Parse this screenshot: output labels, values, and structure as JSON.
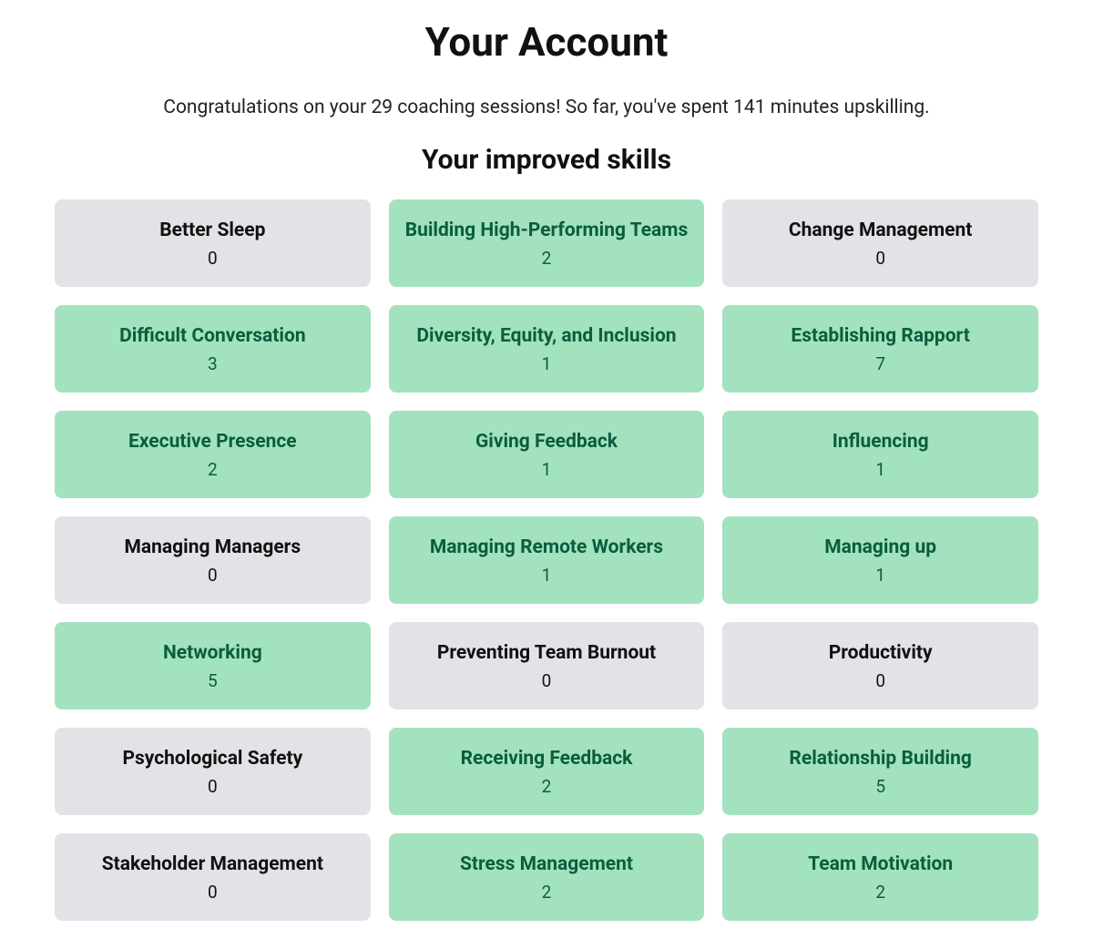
{
  "page_title": "Your Account",
  "congrats_text": "Congratulations on your 29 coaching sessions! So far, you've spent 141 minutes upskilling.",
  "section_title": "Your improved skills",
  "skills": [
    {
      "label": "Better Sleep",
      "count": 0
    },
    {
      "label": "Building High-Performing Teams",
      "count": 2
    },
    {
      "label": "Change Management",
      "count": 0
    },
    {
      "label": "Difficult Conversation",
      "count": 3
    },
    {
      "label": "Diversity, Equity, and Inclusion",
      "count": 1
    },
    {
      "label": "Establishing Rapport",
      "count": 7
    },
    {
      "label": "Executive Presence",
      "count": 2
    },
    {
      "label": "Giving Feedback",
      "count": 1
    },
    {
      "label": "Influencing",
      "count": 1
    },
    {
      "label": "Managing Managers",
      "count": 0
    },
    {
      "label": "Managing Remote Workers",
      "count": 1
    },
    {
      "label": "Managing up",
      "count": 1
    },
    {
      "label": "Networking",
      "count": 5
    },
    {
      "label": "Preventing Team Burnout",
      "count": 0
    },
    {
      "label": "Productivity",
      "count": 0
    },
    {
      "label": "Psychological Safety",
      "count": 0
    },
    {
      "label": "Receiving Feedback",
      "count": 2
    },
    {
      "label": "Relationship Building",
      "count": 5
    },
    {
      "label": "Stakeholder Management",
      "count": 0
    },
    {
      "label": "Stress Management",
      "count": 2
    },
    {
      "label": "Team Motivation",
      "count": 2
    }
  ],
  "colors": {
    "active_bg": "#a3e2be",
    "inactive_bg": "#e2e3e7",
    "active_text": "#0a5d3d",
    "inactive_text": "#111111"
  }
}
